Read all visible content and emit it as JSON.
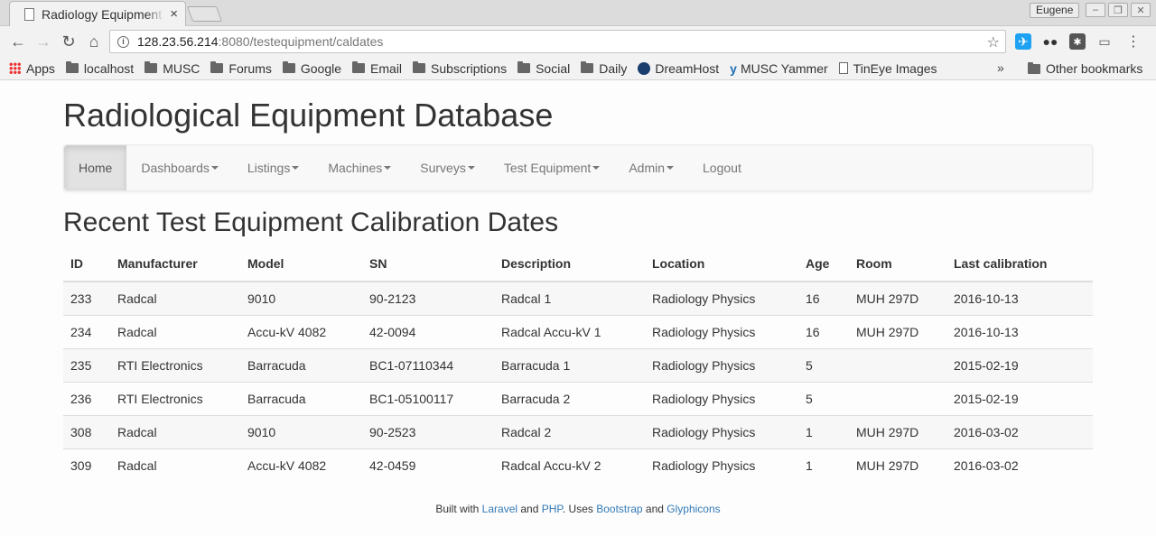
{
  "browser": {
    "tab_title": "Radiology Equipment",
    "tab_close": "×",
    "profile_name": "Eugene",
    "url_host": "128.23.56.214",
    "url_rest": ":8080/testequipment/caldates",
    "bookmarks": [
      {
        "label": "Apps",
        "icon": "apps-icon"
      },
      {
        "label": "localhost",
        "icon": "folder-icon"
      },
      {
        "label": "MUSC",
        "icon": "folder-icon"
      },
      {
        "label": "Forums",
        "icon": "folder-icon"
      },
      {
        "label": "Google",
        "icon": "folder-icon"
      },
      {
        "label": "Email",
        "icon": "folder-icon"
      },
      {
        "label": "Subscriptions",
        "icon": "folder-icon"
      },
      {
        "label": "Social",
        "icon": "folder-icon"
      },
      {
        "label": "Daily",
        "icon": "folder-icon"
      },
      {
        "label": "DreamHost",
        "icon": "dreamhost-icon"
      },
      {
        "label": "MUSC Yammer",
        "icon": "yammer-icon"
      },
      {
        "label": "TinEye Images",
        "icon": "page-icon"
      }
    ],
    "other_bookmarks": "Other bookmarks",
    "more_bookmarks": "»"
  },
  "site": {
    "title": "Radiological Equipment Database"
  },
  "nav": {
    "home": "Home",
    "dashboards": "Dashboards",
    "listings": "Listings",
    "machines": "Machines",
    "surveys": "Surveys",
    "test_equipment": "Test Equipment",
    "admin": "Admin",
    "logout": "Logout"
  },
  "section": {
    "title": "Recent Test Equipment Calibration Dates"
  },
  "table": {
    "headers": {
      "id": "ID",
      "manufacturer": "Manufacturer",
      "model": "Model",
      "sn": "SN",
      "description": "Description",
      "location": "Location",
      "age": "Age",
      "room": "Room",
      "last_calibration": "Last calibration"
    },
    "rows": [
      {
        "id": "233",
        "manufacturer": "Radcal",
        "model": "9010",
        "sn": "90-2123",
        "description": "Radcal 1",
        "location": "Radiology Physics",
        "age": "16",
        "room": "MUH 297D",
        "last_calibration": "2016-10-13"
      },
      {
        "id": "234",
        "manufacturer": "Radcal",
        "model": "Accu-kV 4082",
        "sn": "42-0094",
        "description": "Radcal Accu-kV 1",
        "location": "Radiology Physics",
        "age": "16",
        "room": "MUH 297D",
        "last_calibration": "2016-10-13"
      },
      {
        "id": "235",
        "manufacturer": "RTI Electronics",
        "model": "Barracuda",
        "sn": "BC1-07110344",
        "description": "Barracuda 1",
        "location": "Radiology Physics",
        "age": "5",
        "room": "",
        "last_calibration": "2015-02-19"
      },
      {
        "id": "236",
        "manufacturer": "RTI Electronics",
        "model": "Barracuda",
        "sn": "BC1-05100117",
        "description": "Barracuda 2",
        "location": "Radiology Physics",
        "age": "5",
        "room": "",
        "last_calibration": "2015-02-19"
      },
      {
        "id": "308",
        "manufacturer": "Radcal",
        "model": "9010",
        "sn": "90-2523",
        "description": "Radcal 2",
        "location": "Radiology Physics",
        "age": "1",
        "room": "MUH 297D",
        "last_calibration": "2016-03-02"
      },
      {
        "id": "309",
        "manufacturer": "Radcal",
        "model": "Accu-kV 4082",
        "sn": "42-0459",
        "description": "Radcal Accu-kV 2",
        "location": "Radiology Physics",
        "age": "1",
        "room": "MUH 297D",
        "last_calibration": "2016-03-02"
      }
    ]
  },
  "footer": {
    "built_with": "Built with ",
    "laravel": "Laravel",
    "and1": " and ",
    "php": "PHP",
    "uses": ". Uses ",
    "bootstrap": "Bootstrap",
    "and2": " and ",
    "glyphicons": "Glyphicons"
  }
}
